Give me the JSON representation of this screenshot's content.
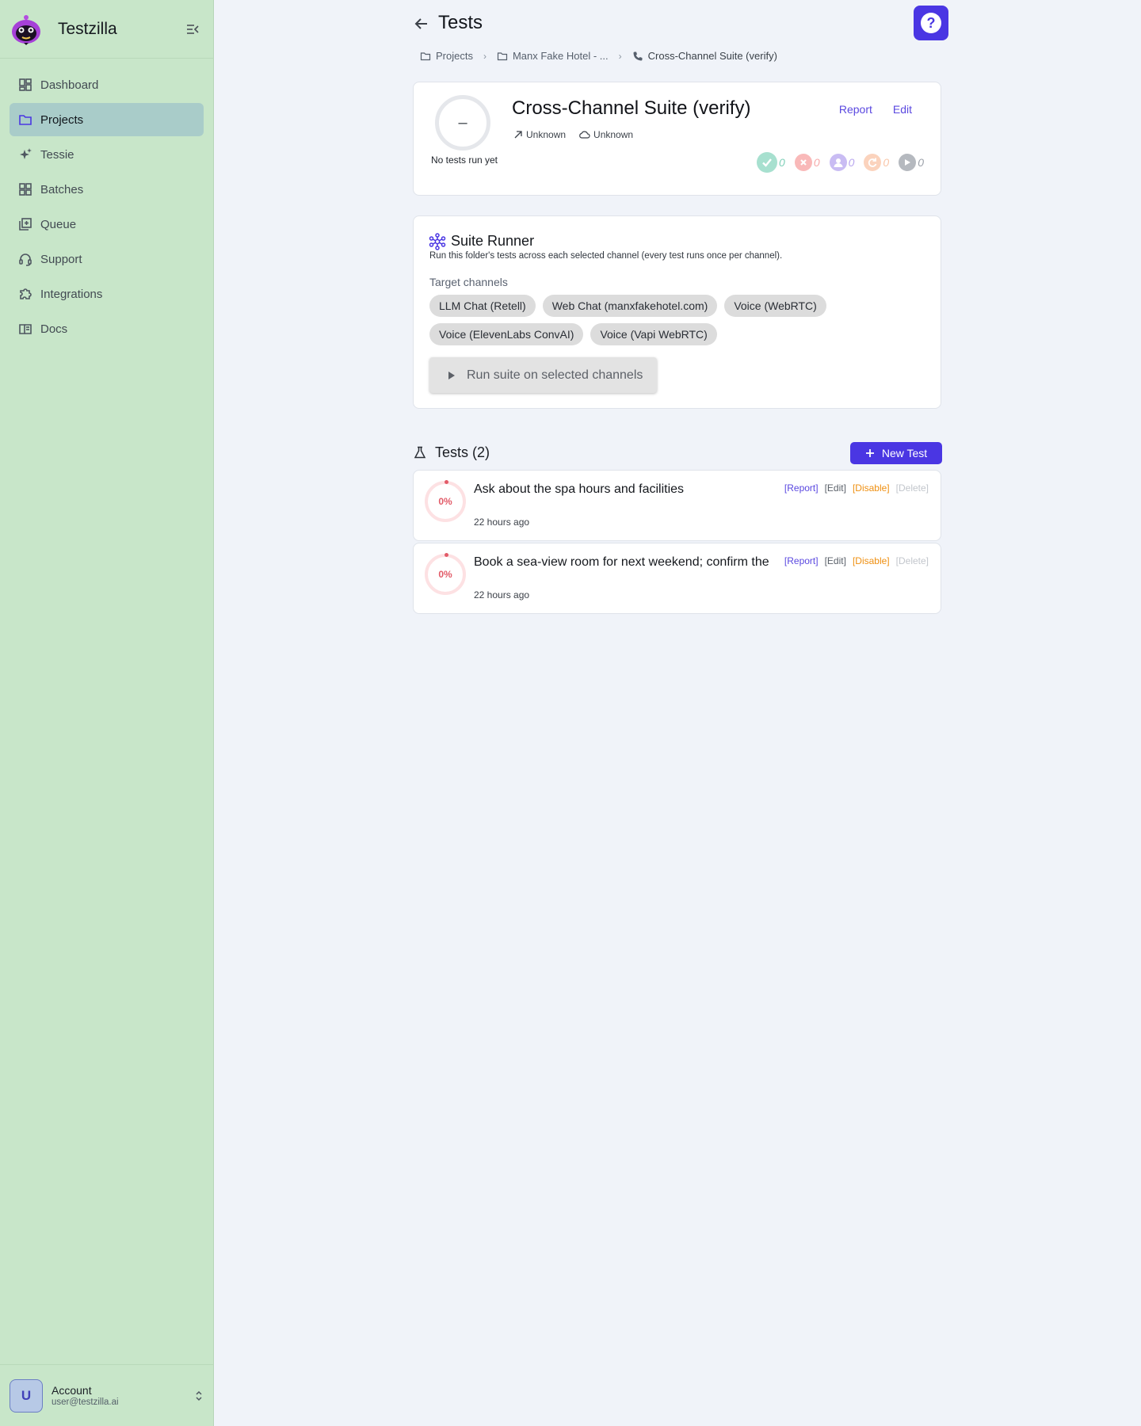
{
  "app": {
    "name": "Testzilla"
  },
  "sidebar": {
    "items": [
      {
        "label": "Dashboard",
        "icon": "dashboard-icon"
      },
      {
        "label": "Projects",
        "icon": "folder-icon",
        "active": true
      },
      {
        "label": "Tessie",
        "icon": "sparkle-icon"
      },
      {
        "label": "Batches",
        "icon": "grid-icon"
      },
      {
        "label": "Queue",
        "icon": "queue-icon"
      },
      {
        "label": "Support",
        "icon": "headset-icon"
      },
      {
        "label": "Integrations",
        "icon": "puzzle-icon"
      },
      {
        "label": "Docs",
        "icon": "book-icon"
      }
    ],
    "account": {
      "initial": "U",
      "label": "Account",
      "email": "user@testzilla.ai"
    }
  },
  "header": {
    "title": "Tests",
    "help": "?"
  },
  "breadcrumb": [
    {
      "label": "Projects",
      "icon": "folder-icon"
    },
    {
      "label": "Manx Fake Hotel - ...",
      "icon": "folder-icon"
    },
    {
      "label": "Cross-Channel Suite (verify)",
      "icon": "phone-icon"
    }
  ],
  "suite": {
    "score": "–",
    "status_text": "No tests run yet",
    "title": "Cross-Channel Suite (verify)",
    "meta": [
      {
        "label": "Unknown",
        "icon": "trend-arrow-icon"
      },
      {
        "label": "Unknown",
        "icon": "cloud-icon"
      }
    ],
    "actions": {
      "report": "Report",
      "edit": "Edit"
    },
    "stats": [
      {
        "name": "passed",
        "value": "0",
        "color": "#7fcfb8"
      },
      {
        "name": "failed",
        "value": "0",
        "color": "#f7a9a9"
      },
      {
        "name": "human",
        "value": "0",
        "color": "#b8a6ee"
      },
      {
        "name": "retry",
        "value": "0",
        "color": "#f9c6a9"
      },
      {
        "name": "pending",
        "value": "0",
        "color": "#9da2aa"
      }
    ]
  },
  "runner": {
    "title": "Suite Runner",
    "description": "Run this folder's tests across each selected channel (every test runs once per channel).",
    "target_label": "Target channels",
    "channels": [
      "LLM Chat (Retell)",
      "Web Chat (manxfakehotel.com)",
      "Voice (WebRTC)",
      "Voice (ElevenLabs ConvAI)",
      "Voice (Vapi WebRTC)"
    ],
    "run_button": "Run suite on selected channels"
  },
  "tests": {
    "heading": "Tests (2)",
    "new_button": "New Test",
    "items": [
      {
        "score": "0%",
        "name": "Ask about the spa hours and facilities",
        "time": "22 hours ago"
      },
      {
        "score": "0%",
        "name": "Book a sea-view room for next weekend; confirm the",
        "time": "22 hours ago"
      }
    ],
    "actions": {
      "report": "[Report]",
      "edit": "[Edit]",
      "disable": "[Disable]",
      "delete": "[Delete]"
    }
  },
  "colors": {
    "accent": "#4a36e3",
    "sidebar_bg": "#c8e6c9",
    "active_item": "#a9ccc9",
    "page_bg": "#f0f3f9"
  }
}
